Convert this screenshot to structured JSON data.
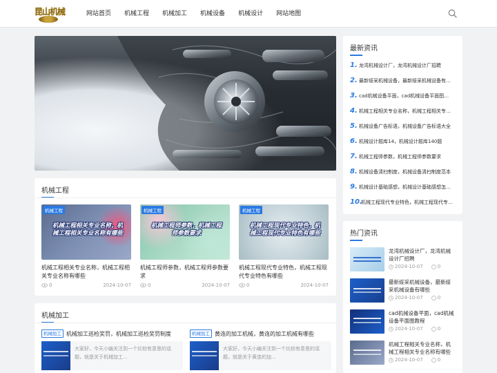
{
  "header": {
    "logo_text": "昆山机械",
    "nav": [
      "网站首页",
      "机械工程",
      "机械加工",
      "机械设备",
      "机械设计",
      "网站地图"
    ]
  },
  "engineering": {
    "title": "机械工程",
    "posts": [
      {
        "tag": "机械工程",
        "thumb_text": "机械工程相关专业名称，机械工程相关专业名称有哪些",
        "title": "机械工程相关专业名称，机械工程相关专业名称有哪些",
        "views": "0",
        "date": "2024-10-07"
      },
      {
        "tag": "机械工程",
        "thumb_text": "机械工程师参数，机械工程师参数要求",
        "title": "机械工程师参数，机械工程师参数要求",
        "views": "0",
        "date": "2024-10-07"
      },
      {
        "tag": "机械工程",
        "thumb_text": "机械工程现代专业特色，机械工程现代专业特色有哪些",
        "title": "机械工程现代专业特色，机械工程现代专业特色有哪些",
        "views": "0",
        "date": "2024-10-07"
      }
    ]
  },
  "processing": {
    "title": "机械加工",
    "items": [
      {
        "tag": "机械加工",
        "title": "机械加工巡检奖罚，机械加工巡检奖罚制度",
        "summary": "大家好，今天小编关注到一个比较有意思的话题，就是关于机械加工..."
      },
      {
        "tag": "机械加工",
        "title": "黄连的加工机械，黄连的加工机械有哪些",
        "summary": "大家好，今天小编关注到一个比较有意思的话题，就是关于黄连的加..."
      }
    ]
  },
  "latest": {
    "title": "最新资讯",
    "items": [
      "龙湾机械设计厂，龙湾机械设计厂招聘",
      "最新绥采机械设备，最新绥采机械设备有哪些",
      "cad机械设备平面，cad机械设备平面图教程",
      "机械工程相关专业名称，机械工程相关专业名称有哪些",
      "机械设备广告标语，机械设备广告标语大全",
      "机械设计题库14，机械设计题库140题",
      "机械工程师参数，机械工程师参数要求",
      "机械设备清扫制度，机械设备清扫制度范本",
      "机械设计基础感想，机械设计基础感想怎么写",
      "机械工程现代专业特色，机械工程现代专业特色有哪些"
    ]
  },
  "hot": {
    "title": "热门资讯",
    "items": [
      {
        "title": "龙湾机械设计厂，龙湾机械设计厂招聘",
        "date": "2024-10-07",
        "comments": "0"
      },
      {
        "title": "最新绥采机械设备，最新绥采机械设备有哪些",
        "date": "2024-10-07",
        "comments": "0"
      },
      {
        "title": "cad机械设备平面，cad机械设备平面图教程",
        "date": "2024-10-07",
        "comments": "0"
      },
      {
        "title": "机械工程相关专业名称，机械工程相关专业名称有哪些",
        "date": "2024-10-07",
        "comments": "0"
      }
    ]
  },
  "colors": {
    "accent": "#2a7ae2",
    "background": "#f1f2f3"
  },
  "icons": {
    "search": "search-icon",
    "views": "eye-icon",
    "date": "clock-icon",
    "comments": "comment-icon"
  }
}
